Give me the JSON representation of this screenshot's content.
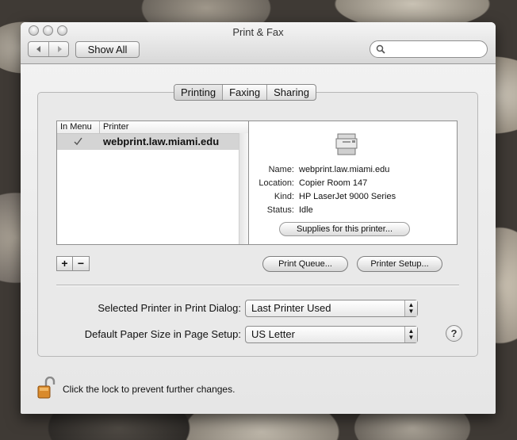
{
  "window": {
    "title": "Print & Fax"
  },
  "toolbar": {
    "back_icon": "left-arrow-icon",
    "forward_icon": "right-arrow-icon",
    "show_all_label": "Show All",
    "search_placeholder": ""
  },
  "tabs": [
    {
      "label": "Printing",
      "active": true
    },
    {
      "label": "Faxing",
      "active": false
    },
    {
      "label": "Sharing",
      "active": false
    }
  ],
  "printer_list": {
    "columns": [
      "In Menu",
      "Printer"
    ],
    "rows": [
      {
        "in_menu": true,
        "name": "webprint.law.miami.edu"
      }
    ]
  },
  "printer_info": {
    "fields": [
      {
        "key": "Name:",
        "value": "webprint.law.miami.edu"
      },
      {
        "key": "Location:",
        "value": "Copier Room 147"
      },
      {
        "key": "Kind:",
        "value": "HP LaserJet 9000 Series"
      },
      {
        "key": "Status:",
        "value": "Idle"
      }
    ],
    "supplies_label": "Supplies for this printer..."
  },
  "list_controls": {
    "add": "+",
    "remove": "−"
  },
  "buttons": {
    "print_queue": "Print Queue...",
    "printer_setup": "Printer Setup..."
  },
  "settings": {
    "selected_printer_label": "Selected Printer in Print Dialog:",
    "selected_printer_value": "Last Printer Used",
    "paper_size_label": "Default Paper Size in Page Setup:",
    "paper_size_value": "US Letter"
  },
  "help_label": "?",
  "lock": {
    "icon": "unlocked-padlock-icon",
    "text": "Click the lock to prevent further changes."
  }
}
